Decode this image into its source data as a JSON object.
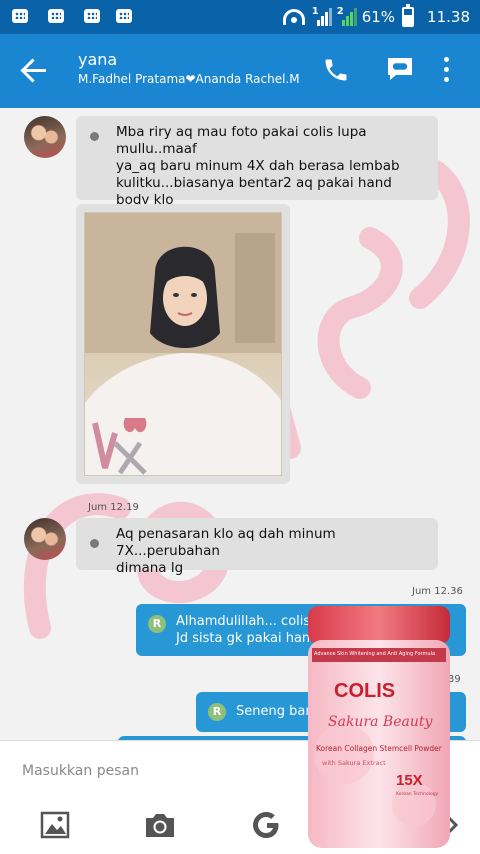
{
  "status_bar": {
    "battery": "61%",
    "time": "11.38",
    "sim1": "1",
    "sim2": "2"
  },
  "header": {
    "title": "yana",
    "subtitle": "M.Fadhel Pratama❤Ananda Rachel.M"
  },
  "messages": [
    {
      "direction": "in",
      "text": "Mba riry aq mau foto pakai colis lupa mullu..maaf\nya_aq baru minum 4X dah berasa lembab\nkulitku...biasanya bentar2 aq pakai hand body klo\ndikantor_hehehhe"
    },
    {
      "direction": "in",
      "type": "photo",
      "timestamp": "Jum 12.19"
    },
    {
      "direction": "in",
      "text": "Aq penasaran klo aq dah minum 7X...perubahan\ndimana lg"
    },
    {
      "direction": "out",
      "timestamp": "Jum 12.36",
      "badge": "R",
      "text": "Alhamdulillah... colisnya\nJd sista gk pakai hand"
    },
    {
      "direction": "out",
      "timestamp": "39",
      "badge": "R",
      "text": "Seneng ban"
    }
  ],
  "watermark_text": "COLIS",
  "product": {
    "header_text": "Advance Skin Whitening and Anti Aging Formula",
    "brand": "COLIS",
    "line": "Sakura Beauty",
    "description": "Korean Collagen Stemcell Powder",
    "description2": "with Sakura Extract",
    "count": "15X",
    "footer": "Korean Technology"
  },
  "composer": {
    "placeholder": "Masukkan pesan"
  },
  "icons": {
    "back": "arrow-left-icon",
    "call": "phone-icon",
    "bbm": "chat-bubble-icon",
    "menu": "more-vertical-icon",
    "gallery": "image-icon",
    "camera": "camera-icon",
    "google": "g-icon",
    "next": "chevron-right-icon"
  },
  "colors": {
    "status_bar": "#0a63a8",
    "app_bar": "#1a85d0",
    "bubble_in": "#e0e0e0",
    "bubble_out": "#2797d6",
    "watermark": "#f4b8c8",
    "brand_red": "#d42a3c"
  }
}
